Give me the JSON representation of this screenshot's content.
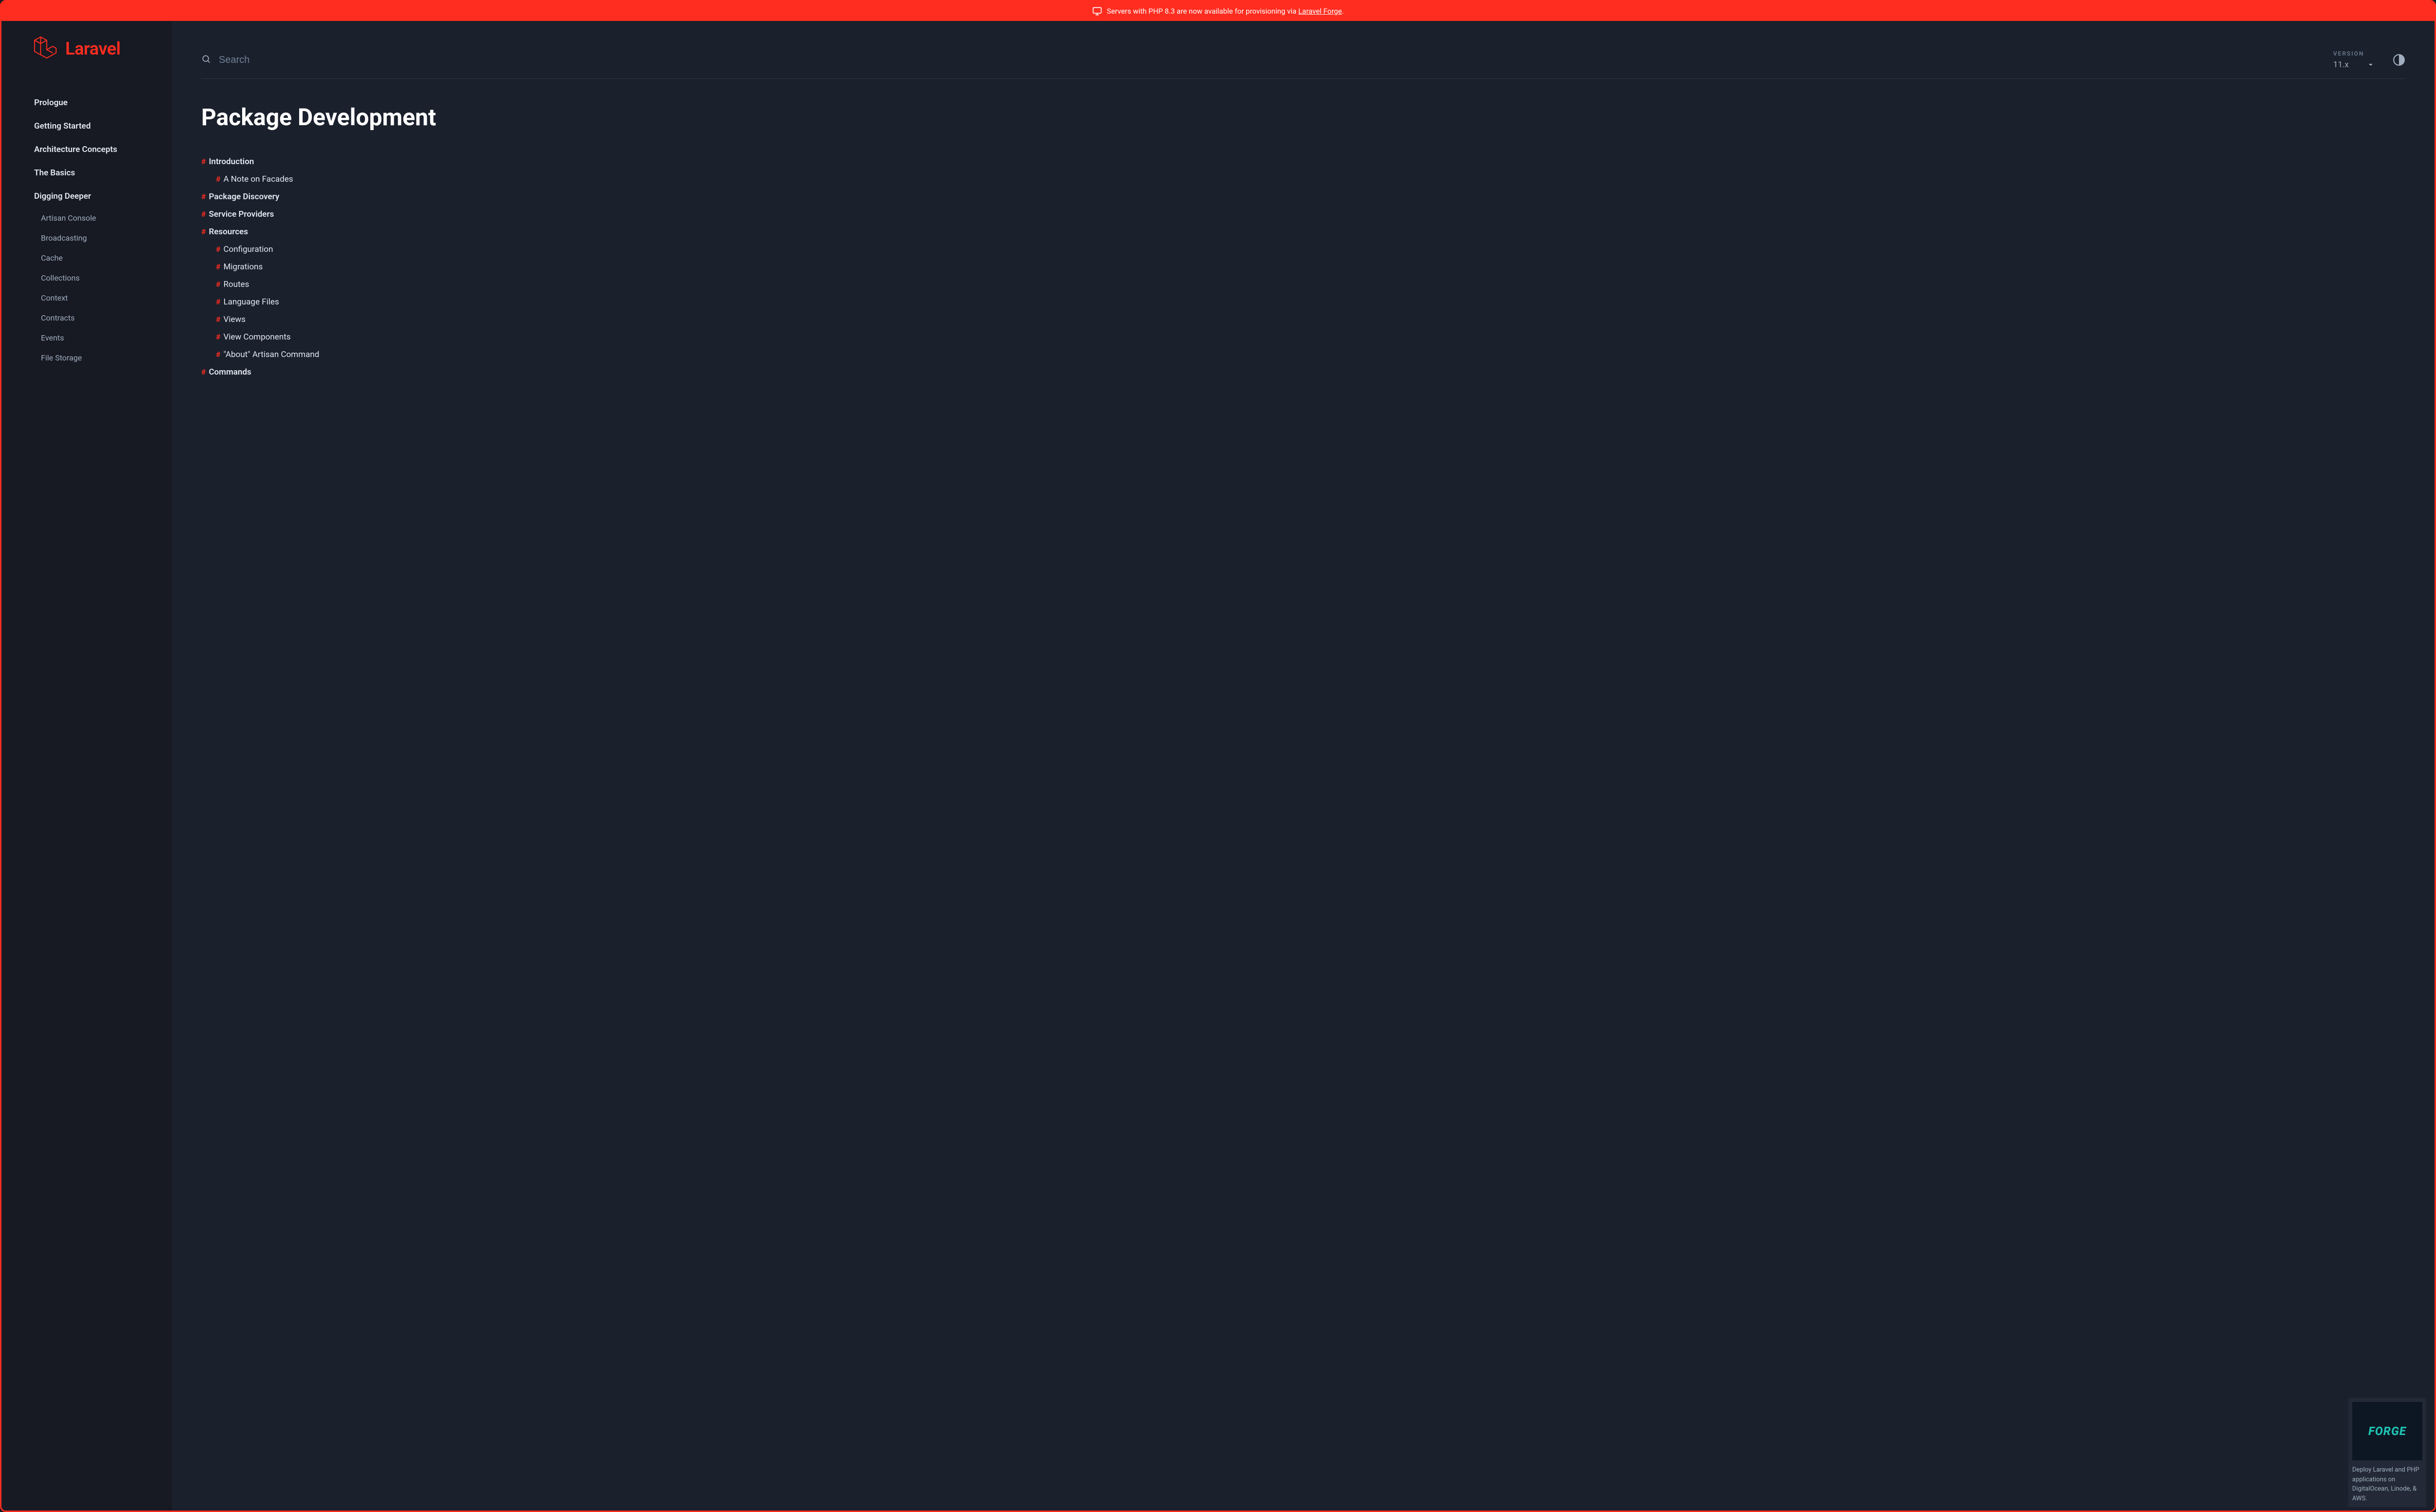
{
  "banner": {
    "text_before": "Servers with PHP 8.3 are now available for provisioning via ",
    "link_text": "Laravel Forge",
    "text_after": "."
  },
  "brand": "Laravel",
  "nav": {
    "sections": [
      {
        "label": "Prologue",
        "children": []
      },
      {
        "label": "Getting Started",
        "children": []
      },
      {
        "label": "Architecture Concepts",
        "children": []
      },
      {
        "label": "The Basics",
        "children": []
      },
      {
        "label": "Digging Deeper",
        "children": [
          "Artisan Console",
          "Broadcasting",
          "Cache",
          "Collections",
          "Context",
          "Contracts",
          "Events",
          "File Storage"
        ]
      }
    ]
  },
  "search": {
    "placeholder": "Search"
  },
  "version": {
    "label": "VERSION",
    "value": "11.x"
  },
  "page": {
    "title": "Package Development"
  },
  "toc": [
    {
      "level": 1,
      "label": "Introduction"
    },
    {
      "level": 2,
      "label": "A Note on Facades"
    },
    {
      "level": 1,
      "label": "Package Discovery"
    },
    {
      "level": 1,
      "label": "Service Providers"
    },
    {
      "level": 1,
      "label": "Resources"
    },
    {
      "level": 2,
      "label": "Configuration"
    },
    {
      "level": 2,
      "label": "Migrations"
    },
    {
      "level": 2,
      "label": "Routes"
    },
    {
      "level": 2,
      "label": "Language Files"
    },
    {
      "level": 2,
      "label": "Views"
    },
    {
      "level": 2,
      "label": "View Components"
    },
    {
      "level": 2,
      "label": "\"About\" Artisan Command"
    },
    {
      "level": 1,
      "label": "Commands"
    }
  ],
  "promo": {
    "name": "FORGE",
    "desc": "Deploy Laravel and PHP applications on DigitalOcean, Linode, & AWS."
  }
}
